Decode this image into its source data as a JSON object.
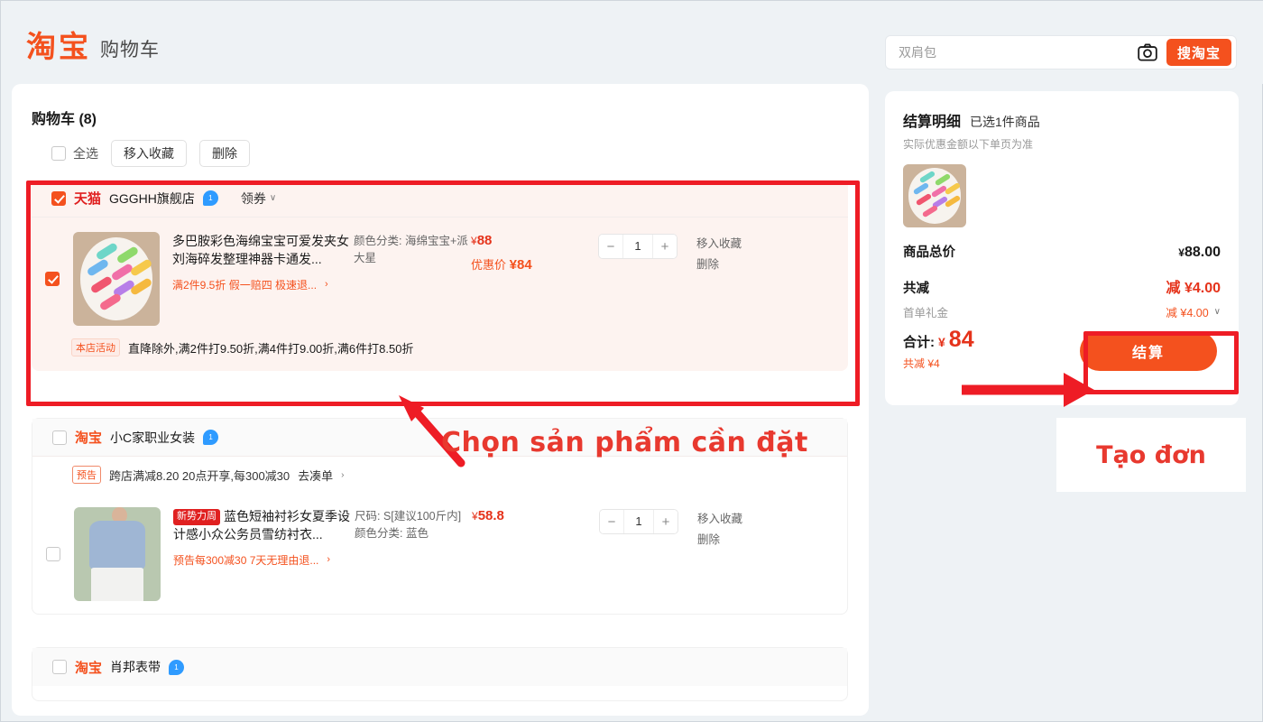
{
  "header": {
    "logo_text": "淘宝",
    "logo_subtitle": "购物车",
    "search_value": "双肩包",
    "search_placeholder": "双肩包",
    "camera_icon": "camera-icon",
    "search_button": "搜淘宝"
  },
  "cart": {
    "title": "购物车 (8)",
    "select_all_label": "全选",
    "select_all_checked": false,
    "move_to_favorites": "移入收藏",
    "delete": "删除",
    "groups": [
      {
        "checked": true,
        "highlighted": true,
        "platform_badge": "天猫",
        "platform_type": "tmall",
        "store_name": "GGGHH旗舰店",
        "chat_icon": "chat-icon",
        "coupon_label": "领券",
        "items": [
          {
            "checked": true,
            "thumb": "colorful-hair-clips-on-plate",
            "title": "多巴胺彩色海绵宝宝可爱发夹女刘海碎发整理神器卡通发...",
            "badge": "",
            "tags": "满2件9.5折  假一赔四  极速退...",
            "sku": "颜色分类: 海绵宝宝+派大星",
            "price": "¥88",
            "price_yen": "¥",
            "price_number": "88",
            "promo_price_label": "优惠价",
            "promo_price": "¥84",
            "quantity": "1",
            "action_favorite": "移入收藏",
            "action_delete": "删除"
          }
        ],
        "shop_promo_tag": "本店活动",
        "shop_promo_text": "直降除外,满2件打9.50折,满4件打9.00折,满6件打8.50折"
      },
      {
        "checked": false,
        "highlighted": false,
        "platform_badge": "淘宝",
        "platform_type": "taobao",
        "store_name": "小C家职业女装",
        "chat_icon": "chat-icon",
        "coupon_label": "",
        "promo_tag": "预告",
        "promo_text": "跨店满减8.20 20点开享,每300减30",
        "promo_link": "去凑单",
        "items": [
          {
            "checked": false,
            "thumb": "blue-shirt-white-skirt",
            "badge": "新势力周",
            "title": "蓝色短袖衬衫女夏季设计感小众公务员雪纺衬衣...",
            "tags": "预告每300减30  7天无理由退...",
            "sku_line1": "尺码: S[建议100斤内]",
            "sku_line2": "颜色分类: 蓝色",
            "price": "¥58.8",
            "price_yen": "¥",
            "price_number": "58.8",
            "quantity": "1",
            "action_favorite": "移入收藏",
            "action_delete": "删除"
          }
        ]
      },
      {
        "checked": false,
        "highlighted": false,
        "platform_badge": "淘宝",
        "platform_type": "taobao",
        "store_name": "肖邦表带",
        "chat_icon": "chat-icon"
      }
    ]
  },
  "summary": {
    "title": "结算明细",
    "selected_count": "已选1件商品",
    "note": "实际优惠金额以下单页为准",
    "thumb": "colorful-hair-clips-on-plate",
    "total_price_label": "商品总价",
    "total_price_yen": "¥",
    "total_price_value": "88.00",
    "discount_label": "共减",
    "discount_value": "减 ¥4.00",
    "first_order_label": "首单礼金",
    "first_order_value": "减 ¥4.00",
    "final_label": "合计:",
    "final_yen": "¥",
    "final_value": "84",
    "final_sub": "共减 ¥4",
    "checkout_button": "结算"
  },
  "annotations": {
    "left_text": "Chọn sản phẩm cần đặt",
    "right_text": "Tạo đơn",
    "color": "#e8392f"
  }
}
